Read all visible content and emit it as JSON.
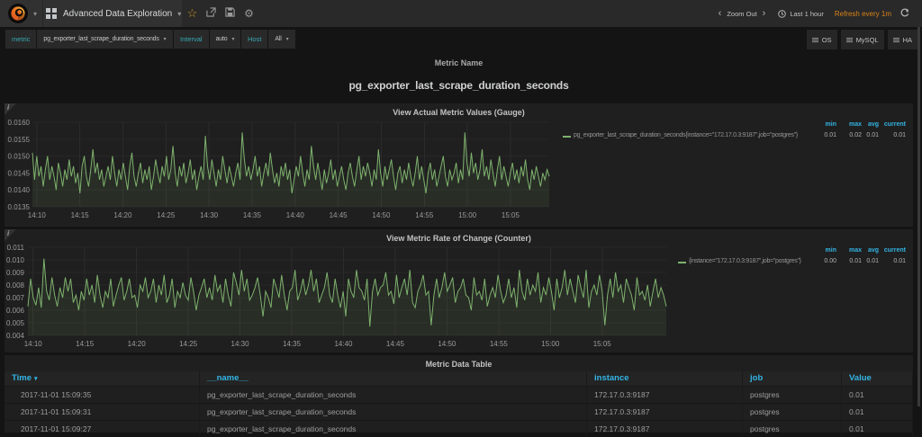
{
  "navbar": {
    "dashboard_title": "Advanced Data Exploration",
    "zoom_out_label": "Zoom Out",
    "time_range_label": "Last 1 hour",
    "refresh_label": "Refresh every 1m"
  },
  "submenu": {
    "variables": [
      {
        "label": "metric",
        "value": "pg_exporter_last_scrape_duration_seconds"
      },
      {
        "label": "Interval",
        "value": "auto"
      },
      {
        "label": "Host",
        "value": "All"
      }
    ],
    "links": [
      {
        "label": "OS"
      },
      {
        "label": "MySQL"
      },
      {
        "label": "HA"
      }
    ]
  },
  "text_panel": {
    "title": "Metric Name",
    "content": "pg_exporter_last_scrape_duration_seconds"
  },
  "colors": {
    "series_green": "#7eb26d",
    "header_blue": "#33b5e5",
    "refresh_orange": "#d9831a",
    "variable_teal": "#35aab4"
  },
  "chart_data": [
    {
      "type": "line",
      "title": "View Actual Metric Values (Gauge)",
      "ylim": [
        0.0135,
        0.016
      ],
      "y_ticks": [
        0.0135,
        0.014,
        0.0145,
        0.015,
        0.0155,
        0.016
      ],
      "y_tick_labels": [
        "0.0135",
        "0.0140",
        "0.0145",
        "0.0150",
        "0.0155",
        "0.0160"
      ],
      "x_tick_labels": [
        "14:10",
        "14:15",
        "14:20",
        "14:25",
        "14:30",
        "14:35",
        "14:40",
        "14:45",
        "14:50",
        "14:55",
        "15:00",
        "15:05"
      ],
      "x_tick_minutes": [
        10,
        15,
        20,
        25,
        30,
        35,
        40,
        45,
        50,
        55,
        60,
        65
      ],
      "x_range_min": [
        9.5,
        69.5
      ],
      "value_scale": 0.0001,
      "series": [
        {
          "name": "pg_exporter_last_scrape_duration_seconds{instance=\"172.17.0.3:9187\",job=\"postgres\"}",
          "values": [
            151,
            143,
            150,
            144,
            147,
            141,
            146,
            150,
            143,
            147,
            144,
            140,
            148,
            145,
            141,
            146,
            143,
            149,
            144,
            147,
            142,
            145,
            139,
            147,
            150,
            144,
            141,
            146,
            152,
            145,
            148,
            143,
            146,
            141,
            144,
            147,
            143,
            150,
            145,
            141,
            146,
            143,
            148,
            144,
            140,
            147,
            151,
            144,
            141,
            145,
            148,
            142,
            146,
            143,
            147,
            140,
            144,
            149,
            145,
            142,
            147,
            144,
            150,
            143,
            146,
            153,
            145,
            141,
            147,
            144,
            148,
            142,
            145,
            149,
            143,
            146,
            140,
            144,
            147,
            143,
            156,
            147,
            143,
            149,
            145,
            141,
            146,
            143,
            150,
            146,
            142,
            147,
            144,
            141,
            145,
            148,
            143,
            157,
            149,
            144,
            147,
            143,
            146,
            150,
            144,
            147,
            141,
            145,
            148,
            144,
            151,
            146,
            142,
            145,
            141,
            147,
            144,
            148,
            143,
            146,
            139,
            143,
            147,
            144,
            150,
            145,
            141,
            146,
            143,
            153,
            147,
            143,
            148,
            144,
            140,
            146,
            142,
            145,
            149,
            143,
            146,
            141,
            144,
            147,
            143,
            140,
            145,
            148,
            144,
            141,
            146,
            150,
            143,
            147,
            144,
            148,
            145,
            141,
            146,
            143,
            152,
            145,
            141,
            147,
            143,
            146,
            149,
            144,
            140,
            145,
            147,
            142,
            146,
            143,
            148,
            144,
            141,
            145,
            150,
            143,
            147,
            143,
            139,
            145,
            148,
            143,
            146,
            141,
            144,
            147,
            150,
            144,
            141,
            146,
            143,
            145,
            148,
            142,
            146,
            143,
            157,
            148,
            144,
            151,
            145,
            148,
            143,
            146,
            152,
            144,
            147,
            143,
            149,
            145,
            141,
            146,
            150,
            143,
            147,
            144,
            141,
            145,
            148,
            143,
            146,
            142,
            147,
            144,
            149,
            143,
            140,
            146,
            143,
            147,
            144,
            141,
            145,
            143,
            146,
            144
          ]
        }
      ],
      "legend": {
        "headers": [
          "min",
          "max",
          "avg",
          "current"
        ],
        "values": [
          "0.01",
          "0.02",
          "0.01",
          "0.01"
        ]
      }
    },
    {
      "type": "line",
      "title": "View Metric Rate of Change (Counter)",
      "ylim": [
        0.004,
        0.011
      ],
      "y_ticks": [
        0.004,
        0.005,
        0.006,
        0.007,
        0.008,
        0.009,
        0.01,
        0.011
      ],
      "y_tick_labels": [
        "0.004",
        "0.005",
        "0.006",
        "0.007",
        "0.008",
        "0.009",
        "0.010",
        "0.011"
      ],
      "x_tick_labels": [
        "14:10",
        "14:15",
        "14:20",
        "14:25",
        "14:30",
        "14:35",
        "14:40",
        "14:45",
        "14:50",
        "14:55",
        "15:00",
        "15:05"
      ],
      "x_tick_minutes": [
        10,
        15,
        20,
        25,
        30,
        35,
        40,
        45,
        50,
        55,
        60,
        65
      ],
      "x_range_min": [
        9.5,
        71.2
      ],
      "value_scale": 0.0001,
      "series": [
        {
          "name": "{instance=\"172.17.0.3:9187\",job=\"postgres\"}",
          "values": [
            63,
            85,
            70,
            64,
            78,
            62,
            101,
            75,
            68,
            86,
            72,
            63,
            78,
            70,
            86,
            75,
            85,
            66,
            72,
            60,
            75,
            68,
            85,
            72,
            80,
            66,
            88,
            72,
            62,
            75,
            70,
            85,
            63,
            72,
            80,
            86,
            68,
            75,
            85,
            70,
            72,
            62,
            80,
            75,
            86,
            70,
            75,
            85,
            66,
            80,
            72,
            88,
            66,
            72,
            85,
            62,
            75,
            70,
            82,
            72,
            68,
            86,
            75,
            60,
            72,
            78,
            85,
            70,
            78,
            68,
            88,
            75,
            80,
            66,
            85,
            72,
            63,
            90,
            82,
            72,
            92,
            75,
            85,
            68,
            72,
            78,
            86,
            72,
            55,
            75,
            70,
            62,
            85,
            78,
            70,
            88,
            72,
            60,
            75,
            78,
            92,
            68,
            75,
            85,
            72,
            80,
            92,
            75,
            85,
            66,
            72,
            78,
            90,
            72,
            66,
            85,
            72,
            62,
            75,
            55,
            85,
            75,
            70,
            92,
            78,
            75,
            68,
            85,
            47,
            75,
            85,
            72,
            78,
            80,
            90,
            72,
            75,
            65,
            88,
            70,
            78,
            85,
            72,
            92,
            66,
            62,
            75,
            80,
            88,
            72,
            75,
            48,
            72,
            85,
            70,
            78,
            90,
            75,
            80,
            86,
            66,
            75,
            78,
            85,
            72,
            70,
            60,
            86,
            72,
            75,
            68,
            85,
            63,
            72,
            78,
            70,
            88,
            75,
            66,
            72,
            85,
            70,
            78,
            62,
            92,
            75,
            68,
            85,
            72,
            80,
            75,
            90,
            66,
            78,
            72,
            86,
            75,
            60,
            85,
            70,
            78,
            92,
            72,
            85,
            75,
            66,
            88,
            78,
            70,
            92,
            62,
            75,
            80,
            72,
            88,
            75,
            48,
            72,
            85,
            70,
            90,
            75,
            80,
            66,
            85,
            78,
            72,
            60,
            86,
            72,
            75,
            68,
            80,
            63,
            75,
            85,
            70,
            78,
            72,
            63
          ]
        }
      ],
      "legend": {
        "headers": [
          "min",
          "max",
          "avg",
          "current"
        ],
        "values": [
          "0.00",
          "0.01",
          "0.01",
          "0.01"
        ]
      }
    }
  ],
  "table_panel": {
    "title": "Metric Data Table",
    "columns": [
      "Time",
      "__name__",
      "instance",
      "job",
      "Value"
    ],
    "sort_column": "Time",
    "rows": [
      [
        "2017-11-01 15:09:35",
        "pg_exporter_last_scrape_duration_seconds",
        "172.17.0.3:9187",
        "postgres",
        "0.01"
      ],
      [
        "2017-11-01 15:09:31",
        "pg_exporter_last_scrape_duration_seconds",
        "172.17.0.3:9187",
        "postgres",
        "0.01"
      ],
      [
        "2017-11-01 15:09:27",
        "pg_exporter_last_scrape_duration_seconds",
        "172.17.0.3:9187",
        "postgres",
        "0.01"
      ]
    ]
  }
}
